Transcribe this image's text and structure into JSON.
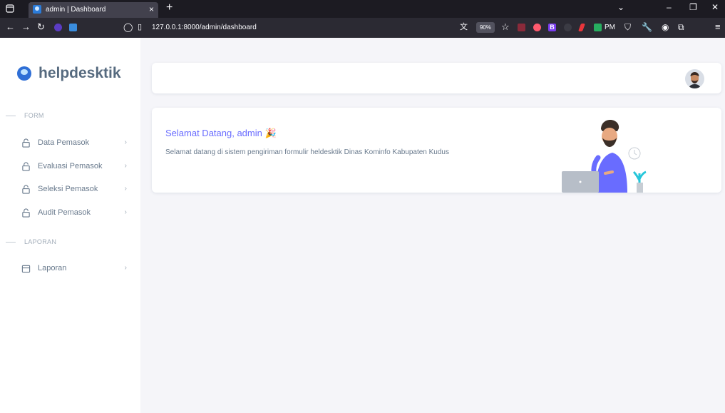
{
  "browser": {
    "tab_title": "admin | Dashboard",
    "tab_close": "×",
    "new_tab": "+",
    "url": "127.0.0.1:8000/admin/dashboard",
    "zoom": "90%",
    "ext_label_b": "B",
    "ext_label_pm": "PM",
    "window_controls": {
      "list": "⌄",
      "minimize": "–",
      "restore": "❐",
      "close": "✕"
    }
  },
  "sidebar": {
    "brand": "helpdesktik",
    "sections": [
      {
        "label": "FORM"
      },
      {
        "label": "LAPORAN"
      }
    ],
    "items": [
      {
        "label": "Data Pemasok",
        "icon": "lock-icon"
      },
      {
        "label": "Evaluasi Pemasok",
        "icon": "lock-icon"
      },
      {
        "label": "Seleksi Pemasok",
        "icon": "lock-icon"
      },
      {
        "label": "Audit Pemasok",
        "icon": "lock-icon"
      },
      {
        "label": "Laporan",
        "icon": "calendar-icon"
      }
    ],
    "chevron": "›"
  },
  "welcome": {
    "title": "Selamat Datang, admin 🎉",
    "text": "Selamat datang di sistem pengiriman formulir heldesktik Dinas Kominfo Kabupaten Kudus"
  },
  "colors": {
    "accent": "#696cff",
    "text": "#697a8d",
    "background": "#f5f5f9"
  }
}
